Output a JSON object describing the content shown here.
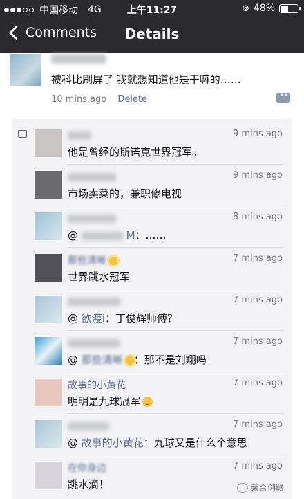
{
  "status_bar": {
    "carrier": "中国移动",
    "network": "4G",
    "time": "上午11:27",
    "battery": "48%"
  },
  "nav": {
    "back_label": "Comments",
    "title": "Details"
  },
  "post": {
    "text": "被科比刷屏了 我就想知道他是干嘛的……",
    "time": "10 mins ago",
    "delete_label": "Delete"
  },
  "comments": [
    {
      "name": "",
      "time": "9 mins ago",
      "text": "他是曾经的斯诺克世界冠军。"
    },
    {
      "name": "",
      "time": "9 mins ago",
      "text": "市场卖菜的，兼职修电视"
    },
    {
      "name": "",
      "time": "8 mins ago",
      "text_prefix": "@",
      "text_mid": "M",
      "text_suffix": "：……"
    },
    {
      "name": "那些清晰",
      "time": "7 mins ago",
      "text": "世界跳水冠军"
    },
    {
      "name": "",
      "time": "7 mins ago",
      "text_prefix": "@",
      "at_name": "欲渡i",
      "text_suffix": "：丁俊辉师傅？"
    },
    {
      "name": "",
      "time": "7 mins ago",
      "text_prefix": "@",
      "at_name": "那些清晰",
      "text_suffix": "：那不是刘翔吗"
    },
    {
      "name": "故事的小黄花",
      "time": "7 mins ago",
      "text": "明明是九球冠军"
    },
    {
      "name": "",
      "time": "7 mins ago",
      "text_prefix": "@",
      "at_name": "故事的小黄花",
      "text_suffix": "：九球又是什么个意思"
    },
    {
      "name": "在你身边",
      "time": "7 mins ago",
      "text": "跳水滴！"
    }
  ],
  "watermark": "荣合创联",
  "icons": [
    "back-chevron-icon",
    "comment-bubble-icon",
    "like-icon",
    "sun-emoji-icon",
    "smiley-emoji-icon",
    "alarm-icon"
  ]
}
